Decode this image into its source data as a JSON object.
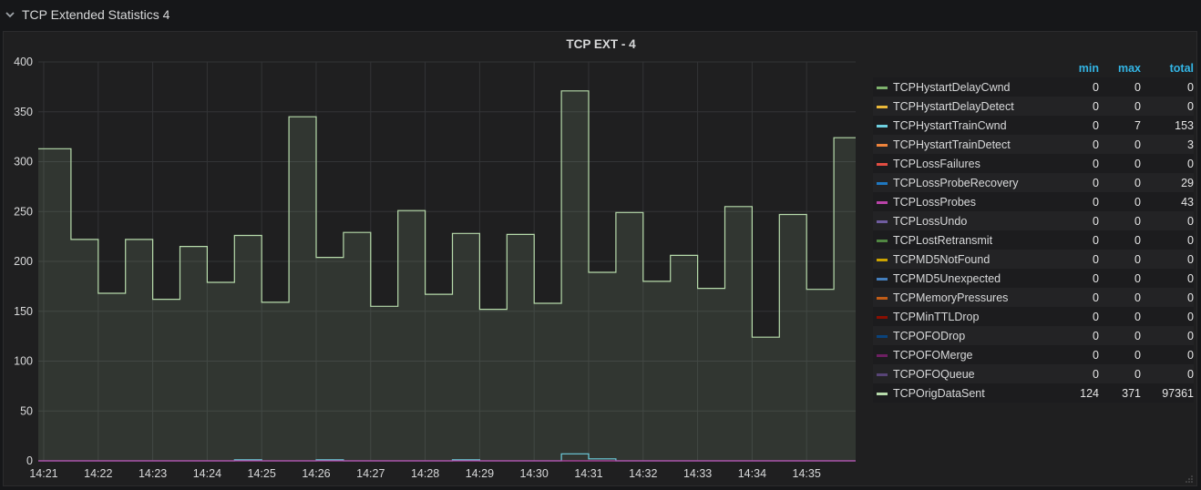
{
  "row": {
    "title": "TCP Extended Statistics 4"
  },
  "panel": {
    "title": "TCP EXT - 4"
  },
  "legend": {
    "headers": [
      "min",
      "max",
      "total"
    ],
    "items": [
      {
        "name": "TCPHystartDelayCwnd",
        "color": "#7eb26d",
        "min": "0",
        "max": "0",
        "total": "0"
      },
      {
        "name": "TCPHystartDelayDetect",
        "color": "#eab839",
        "min": "0",
        "max": "0",
        "total": "0"
      },
      {
        "name": "TCPHystartTrainCwnd",
        "color": "#6ed0e0",
        "min": "0",
        "max": "7",
        "total": "153"
      },
      {
        "name": "TCPHystartTrainDetect",
        "color": "#ef843c",
        "min": "0",
        "max": "0",
        "total": "3"
      },
      {
        "name": "TCPLossFailures",
        "color": "#e24d42",
        "min": "0",
        "max": "0",
        "total": "0"
      },
      {
        "name": "TCPLossProbeRecovery",
        "color": "#1f78c1",
        "min": "0",
        "max": "0",
        "total": "29"
      },
      {
        "name": "TCPLossProbes",
        "color": "#ba43a9",
        "min": "0",
        "max": "0",
        "total": "43"
      },
      {
        "name": "TCPLossUndo",
        "color": "#705da0",
        "min": "0",
        "max": "0",
        "total": "0"
      },
      {
        "name": "TCPLostRetransmit",
        "color": "#508642",
        "min": "0",
        "max": "0",
        "total": "0"
      },
      {
        "name": "TCPMD5NotFound",
        "color": "#cca300",
        "min": "0",
        "max": "0",
        "total": "0"
      },
      {
        "name": "TCPMD5Unexpected",
        "color": "#447ebc",
        "min": "0",
        "max": "0",
        "total": "0"
      },
      {
        "name": "TCPMemoryPressures",
        "color": "#c15c17",
        "min": "0",
        "max": "0",
        "total": "0"
      },
      {
        "name": "TCPMinTTLDrop",
        "color": "#890f02",
        "min": "0",
        "max": "0",
        "total": "0"
      },
      {
        "name": "TCPOFODrop",
        "color": "#0a437c",
        "min": "0",
        "max": "0",
        "total": "0"
      },
      {
        "name": "TCPOFOMerge",
        "color": "#6d1f62",
        "min": "0",
        "max": "0",
        "total": "0"
      },
      {
        "name": "TCPOFOQueue",
        "color": "#584477",
        "min": "0",
        "max": "0",
        "total": "0"
      },
      {
        "name": "TCPOrigDataSent",
        "color": "#b7dbab",
        "min": "124",
        "max": "371",
        "total": "97361"
      }
    ]
  },
  "chart_data": {
    "type": "line",
    "title": "TCP EXT - 4",
    "ylim": [
      0,
      400
    ],
    "yticks": [
      0,
      50,
      100,
      150,
      200,
      250,
      300,
      350,
      400
    ],
    "xticks": [
      "14:21",
      "14:22",
      "14:23",
      "14:24",
      "14:25",
      "14:26",
      "14:27",
      "14:28",
      "14:29",
      "14:30",
      "14:31",
      "14:32",
      "14:33",
      "14:34",
      "14:35"
    ],
    "xrange_minutes": [
      -0.1,
      14.9
    ],
    "grid": true,
    "series": [
      {
        "name": "TCPOrigDataSent",
        "color": "#b7dbab",
        "fill": true,
        "step": true,
        "x": [
          -0.1,
          0.5,
          1.0,
          1.5,
          2.0,
          2.5,
          3.0,
          3.5,
          4.0,
          4.5,
          5.0,
          5.5,
          6.0,
          6.5,
          7.0,
          7.5,
          8.0,
          8.5,
          9.0,
          9.5,
          10.0,
          10.5,
          11.0,
          11.5,
          12.0,
          12.5,
          13.0,
          13.5,
          14.0,
          14.5
        ],
        "values": [
          313,
          222,
          168,
          222,
          162,
          215,
          179,
          226,
          159,
          345,
          204,
          229,
          155,
          251,
          167,
          228,
          152,
          227,
          158,
          371,
          189,
          249,
          180,
          206,
          173,
          255,
          124,
          247,
          172,
          324
        ]
      },
      {
        "name": "TCPHystartTrainCwnd",
        "color": "#6ed0e0",
        "step": true,
        "x": [
          -0.1,
          3.5,
          4.0,
          5.0,
          5.5,
          7.5,
          8.0,
          9.5,
          10.0,
          10.5
        ],
        "values": [
          0,
          1,
          0,
          1,
          0,
          1,
          0,
          7,
          2,
          0
        ]
      },
      {
        "name": "TCPLossProbes",
        "color": "#ba43a9",
        "step": false,
        "x": [
          -0.1,
          14.9
        ],
        "values": [
          0,
          0
        ]
      }
    ]
  }
}
